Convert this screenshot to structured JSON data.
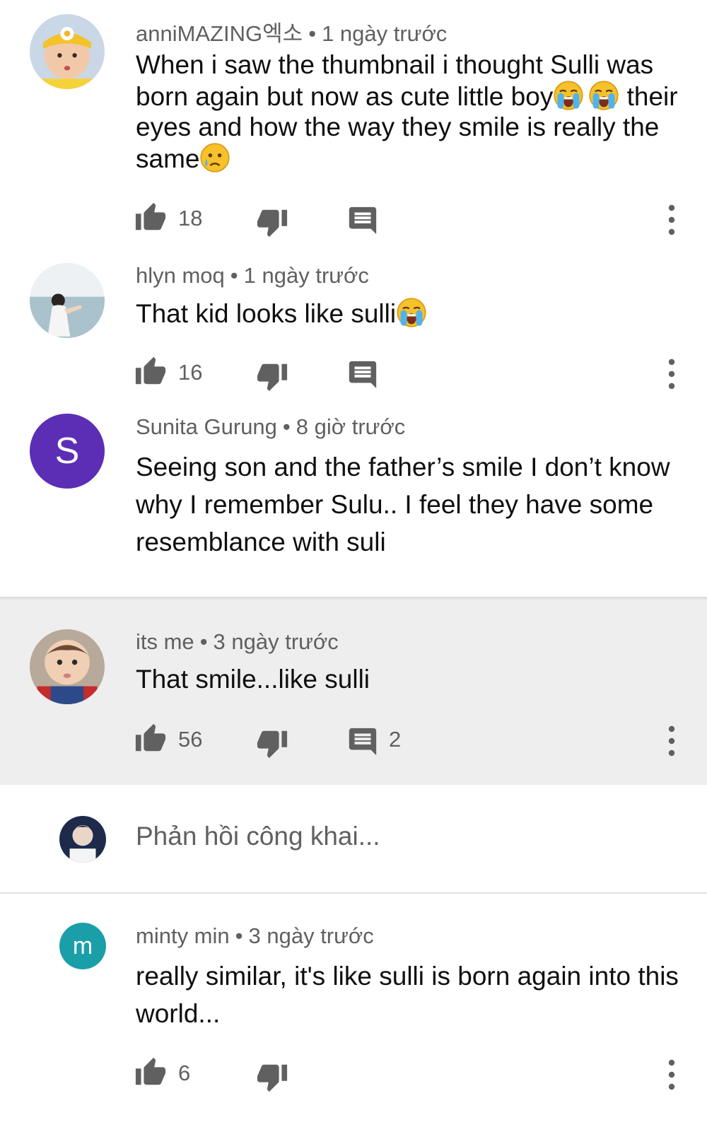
{
  "comments": [
    {
      "author": "anniMAZING엑소",
      "time": "1 ngày trước",
      "text_parts": [
        "When i saw the thumbnail i thought Sulli was born again but now as cute little boy",
        "their eyes and how the way they smile is really the same"
      ],
      "likes": "18",
      "replies": ""
    },
    {
      "author": "hlyn moq",
      "time": "1 ngày trước",
      "text": "That kid looks like sulli",
      "likes": "16",
      "replies": ""
    },
    {
      "author": "Sunita Gurung",
      "time": "8 giờ trước",
      "avatar_letter": "S",
      "avatar_color": "#5b2eb5",
      "text": "Seeing son and the father’s smile I don’t know why I remember Sulu.. I feel they have some resemblance with suli"
    },
    {
      "author": "its me",
      "time": "3 ngày trước",
      "text": "That smile...like sulli",
      "likes": "56",
      "replies": "2",
      "highlight_color": "#eeeeee"
    },
    {
      "author": "minty min",
      "time": "3 ngày trước",
      "avatar_letter": "m",
      "avatar_color": "#1a9fa8",
      "text": "really similar, it's like sulli is born again into this world...",
      "likes": "6"
    }
  ],
  "reply_box": {
    "placeholder": "Phản hồi công khai..."
  },
  "dot": "•",
  "icons": [
    "thumb-up-icon",
    "thumb-down-icon",
    "reply-icon",
    "more-vert-icon",
    "loudly-crying-emoji",
    "crying-emoji"
  ]
}
